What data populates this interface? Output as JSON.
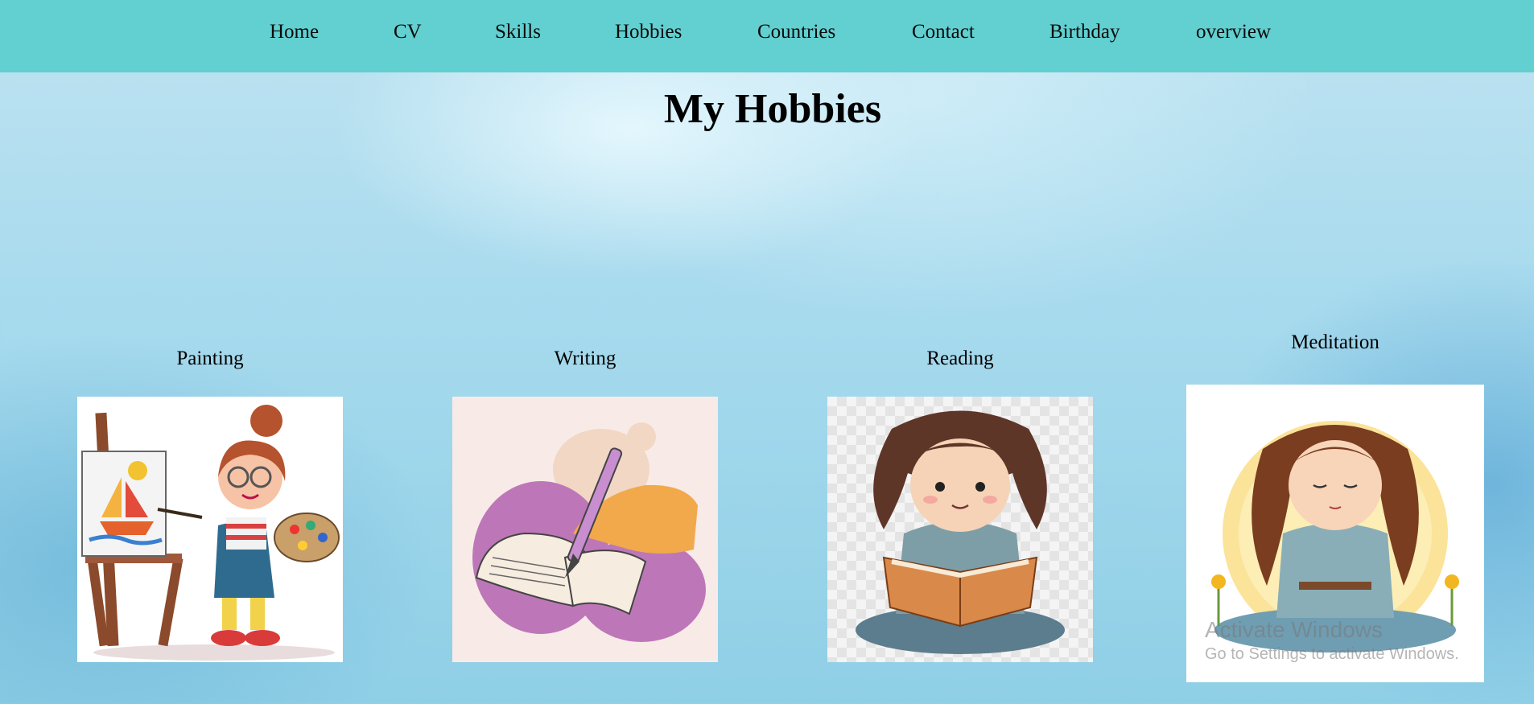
{
  "nav": {
    "items": [
      {
        "label": "Home"
      },
      {
        "label": "CV"
      },
      {
        "label": "Skills"
      },
      {
        "label": "Hobbies"
      },
      {
        "label": "Countries"
      },
      {
        "label": "Contact"
      },
      {
        "label": "Birthday"
      },
      {
        "label": "overview"
      }
    ]
  },
  "page": {
    "title": "My Hobbies"
  },
  "hobbies": [
    {
      "label": "Painting",
      "icon": "painting-girl-illustration"
    },
    {
      "label": "Writing",
      "icon": "writing-hand-illustration"
    },
    {
      "label": "Reading",
      "icon": "reading-girl-illustration"
    },
    {
      "label": "Meditation",
      "icon": "meditating-girl-illustration"
    }
  ],
  "watermark": {
    "title": "Activate Windows",
    "subtitle": "Go to Settings to activate Windows."
  },
  "colors": {
    "navbar": "#62cfd0",
    "background": "#a9dbee"
  }
}
